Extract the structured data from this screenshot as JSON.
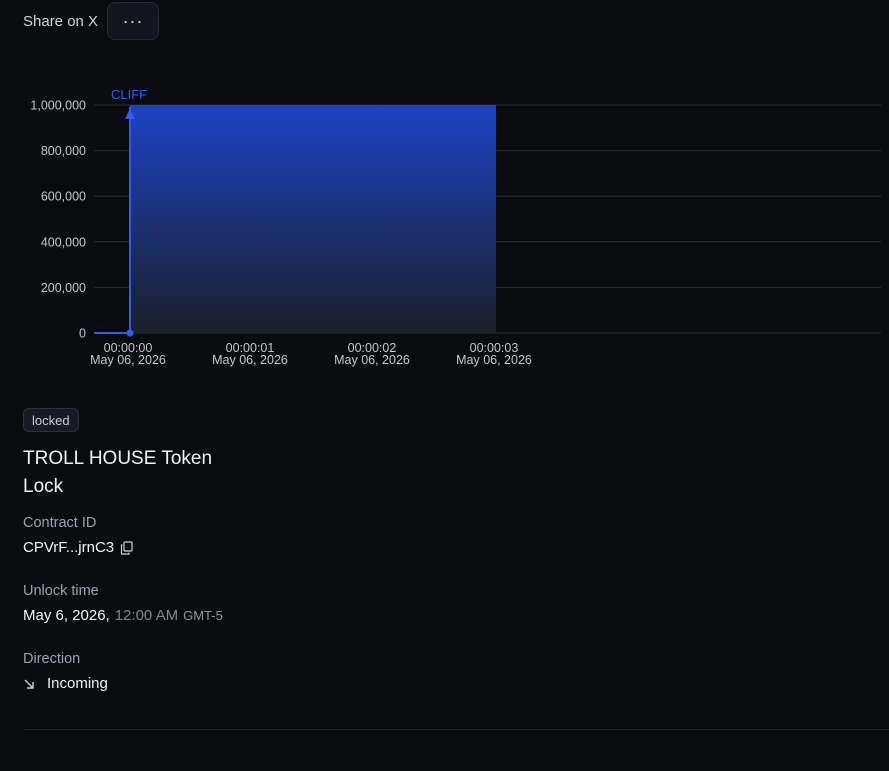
{
  "header": {
    "share_label": "Share on X",
    "more_label": "···"
  },
  "chart_data": {
    "type": "area",
    "annotation": "CLIFF",
    "x": [
      {
        "time": "00:00:00",
        "date": "May 06, 2026"
      },
      {
        "time": "00:00:01",
        "date": "May 06, 2026"
      },
      {
        "time": "00:00:02",
        "date": "May 06, 2026"
      },
      {
        "time": "00:00:03",
        "date": "May 06, 2026"
      }
    ],
    "y_ticks": [
      0,
      200000,
      400000,
      600000,
      800000,
      1000000
    ],
    "y_tick_labels": [
      "0",
      "200,000",
      "400,000",
      "600,000",
      "800,000",
      "1,000,000"
    ],
    "ylim": [
      0,
      1000000
    ],
    "series": [
      {
        "points": [
          [
            0,
            0
          ],
          [
            0,
            1000000
          ],
          [
            3,
            1000000
          ]
        ]
      }
    ],
    "grid": true,
    "colors": {
      "line": "#2d5cf0",
      "fill_top": "#1c43c4",
      "fill_bottom": "#1b1f2a",
      "grid": "#2a2e37",
      "axis_text": "#c3c7ce"
    }
  },
  "lock": {
    "status_badge": "locked",
    "title": "TROLL HOUSE Token Lock",
    "contract_label": "Contract ID",
    "contract_value": "CPVrF...jrnC3",
    "unlock_label": "Unlock time",
    "unlock_date": "May 6, 2026,",
    "unlock_time": "12:00 AM",
    "unlock_tz": "GMT-5",
    "direction_label": "Direction",
    "direction_value": "Incoming",
    "direction_icon": "arrow-down-right-icon"
  }
}
